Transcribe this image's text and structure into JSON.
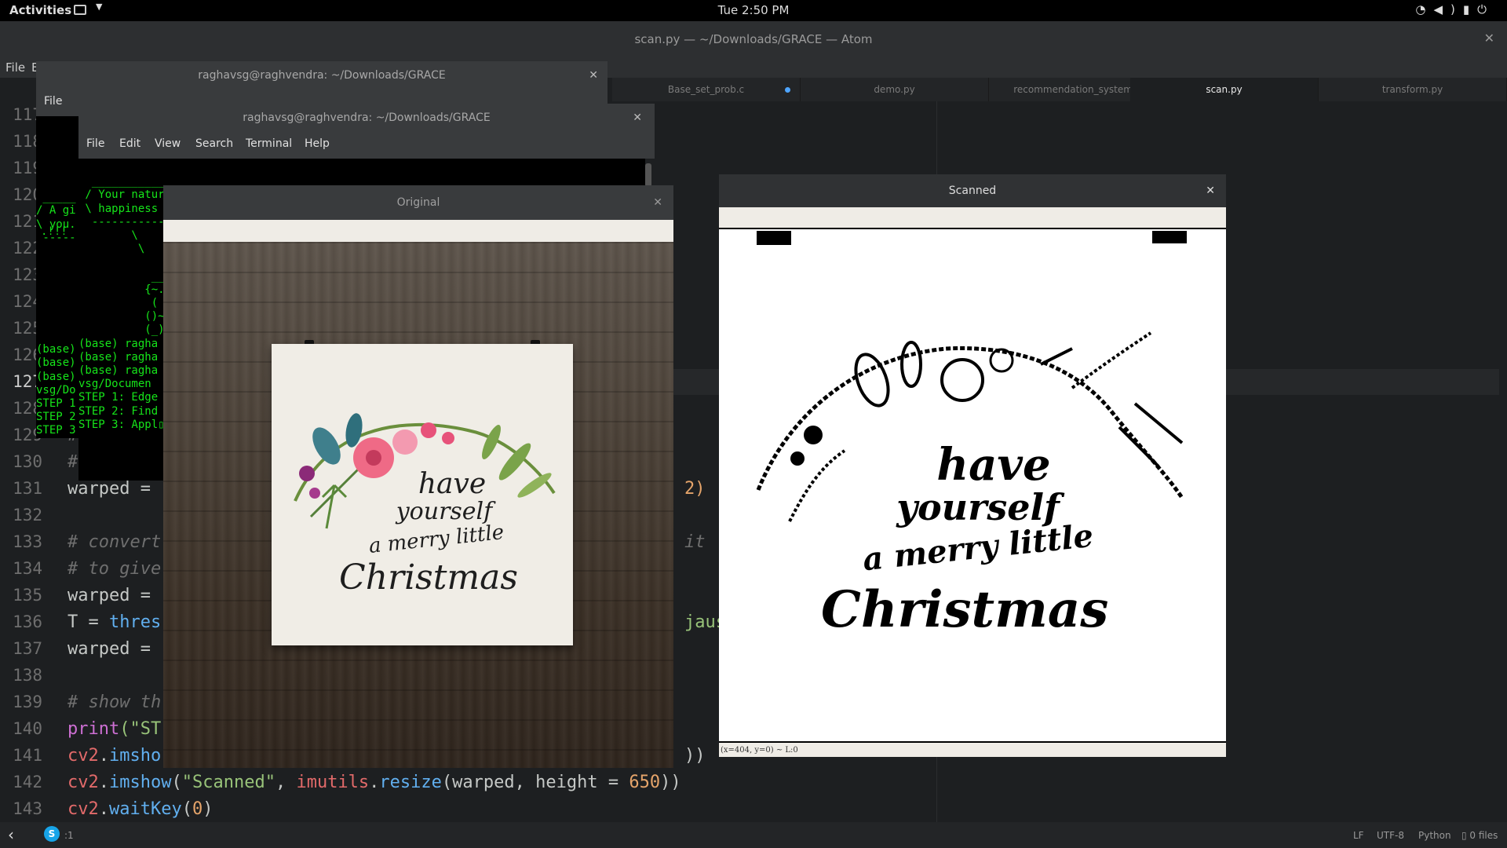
{
  "topbar": {
    "activities": "Activities",
    "clock": "Tue  2:50 PM",
    "tray_icons": [
      "wifi-icon",
      "volume-icon",
      "battery-icon",
      "power-icon"
    ]
  },
  "atom": {
    "title": "scan.py — ~/Downloads/GRACE — Atom",
    "menu": [
      "File",
      "E"
    ],
    "tabs": [
      {
        "label": "Base_set_prob.c",
        "modified": true
      },
      {
        "label": "demo.py"
      },
      {
        "label": "recommendation_systems.py"
      },
      {
        "label": "scan.py",
        "active": true
      },
      {
        "label": "transform.py"
      }
    ],
    "line_numbers": [
      "117",
      "118",
      "119",
      "120",
      "121",
      "122",
      "123",
      "124",
      "125",
      "126",
      "127",
      "128",
      "129",
      "130",
      "131",
      "132",
      "133",
      "134",
      "135",
      "136",
      "137",
      "138",
      "139",
      "140",
      "141",
      "142",
      "143"
    ],
    "current_line": "127",
    "code": {
      "l129": "#",
      "l130": "#",
      "l131_a": "warped = ",
      "l131_b": "2)",
      "l133_a": "# convert",
      "l133_b": "it",
      "l134": "# to give",
      "l135": "warped = ",
      "l136_a": "T = ",
      "l136_fn": "thres",
      "l136_b": "jauss",
      "l137": "warped = ",
      "l139": "# show th",
      "l140_fn": "print",
      "l140_st": "(\"ST",
      "l141_a": "cv2",
      "l141_fn": "imsho",
      "l141_b": "))",
      "l142_a": "cv2",
      "l142_fn": "imshow",
      "l142_st": "\"Scanned\"",
      "l142_mod": "imutils",
      "l142_fn2": "resize",
      "l142_arg": "(warped, height = ",
      "l142_num": "650",
      "l142_end": "))",
      "l143_a": "cv2",
      "l143_fn": "waitKey",
      "l143_num": "0"
    },
    "status": {
      "cursor": ":1",
      "line_ending": "LF",
      "encoding": "UTF-8",
      "grammar": "Python",
      "files": "0 files"
    }
  },
  "terminal_back": {
    "title": "raghavsg@raghvendra: ~/Downloads/GRACE",
    "menu": [
      "File"
    ],
    "lines": [
      " _____",
      "/ A gi",
      "\\ you.",
      " -----",
      "",
      "",
      "",
      "",
      "",
      "",
      "",
      "",
      "",
      "",
      "",
      "",
      "(base)",
      "(base)",
      "(base)",
      "vsg/Do",
      "STEP 1",
      "STEP 2",
      "STEP 3"
    ]
  },
  "terminal_front": {
    "title": "raghavsg@raghvendra: ~/Downloads/GRACE",
    "menu": [
      "File",
      "Edit",
      "View",
      "Search",
      "Terminal",
      "Help"
    ],
    "lines": [
      "  ___________________________________",
      " / Your nature demands love and your \\",
      " \\ happiness",
      "  -----------",
      "        \\",
      "         \\",
      "",
      "           ___",
      "          {~._.~}",
      "           ( Y )",
      "          ()~*~()",
      "          (_)-(_)",
      "(base) ragha",
      "(base) ragha",
      "(base) ragha",
      "vsg/Documen",
      "STEP 1: Edge",
      "STEP 2: Find",
      "STEP 3: Appl"
    ],
    "left_lines": [
      ".!!!  \\",
      " ~~~~   \\"
    ]
  },
  "original_window": {
    "title": "Original",
    "poster_text": [
      "have",
      "yourself",
      "a merry little",
      "Christmas"
    ]
  },
  "scanned_window": {
    "title": "Scanned",
    "poster_text": [
      "have",
      "yourself",
      "a merry little",
      "Christmas"
    ],
    "status": "(x=404, y=0) ~ L:0"
  }
}
